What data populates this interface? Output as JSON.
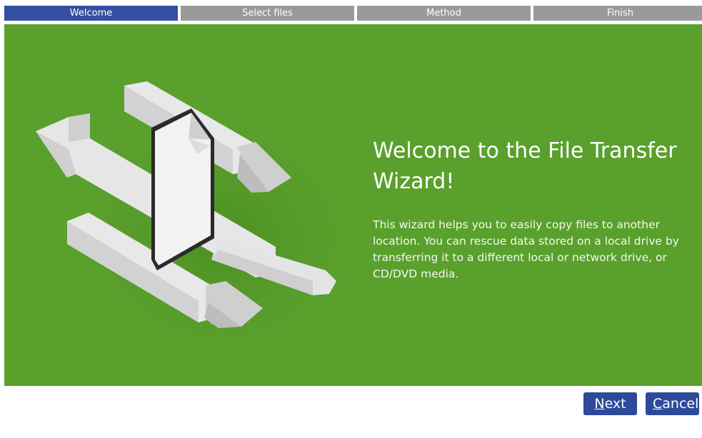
{
  "steps": [
    {
      "label": "Welcome",
      "active": true
    },
    {
      "label": "Select files",
      "active": false
    },
    {
      "label": "Method",
      "active": false
    },
    {
      "label": "Finish",
      "active": false
    }
  ],
  "content": {
    "title": "Welcome to the File Transfer Wizard!",
    "description": "This wizard helps you to easily copy files to another location. You can rescue data stored on a local drive by transferring it to a different local or network drive, or CD/DVD media."
  },
  "buttons": {
    "next": {
      "mnemonic": "N",
      "rest": "ext ›"
    },
    "cancel": {
      "mnemonic": "C",
      "rest": "ancel"
    }
  },
  "colors": {
    "panel": "#5aa02c",
    "active_step": "#3450a0",
    "inactive_step": "#9a9a9a",
    "button": "#2d4a9a"
  }
}
